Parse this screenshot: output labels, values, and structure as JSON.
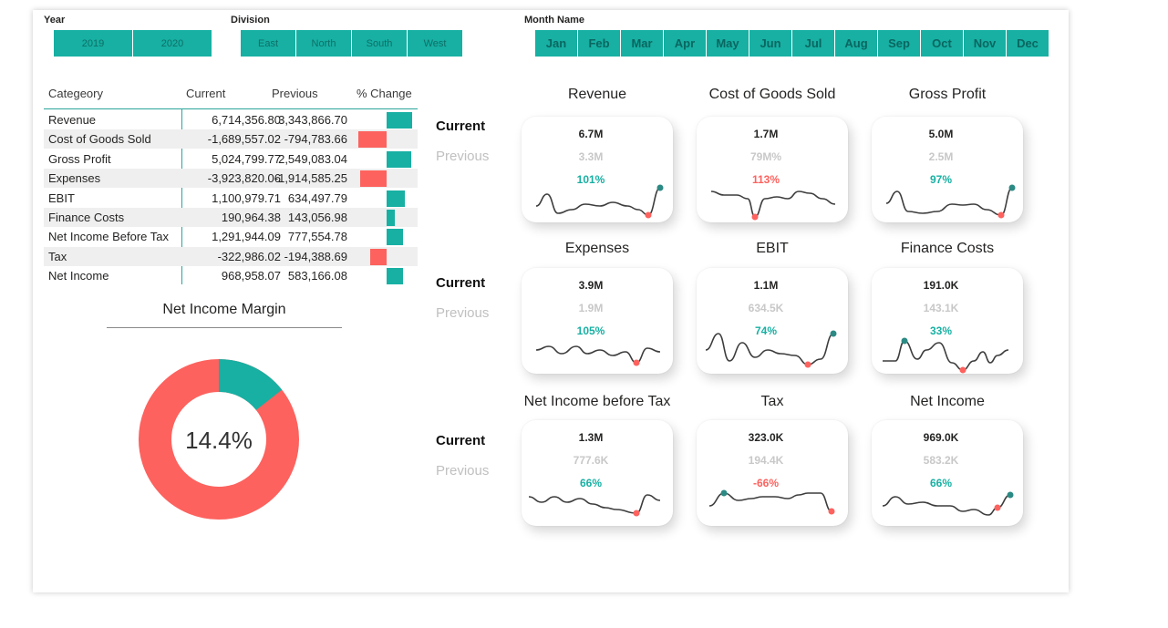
{
  "colors": {
    "teal": "#17b0a3",
    "red": "#fd625e",
    "dark_teal": "#2c8a84",
    "line": "#3d3d3d",
    "muted": "#c8c8c8"
  },
  "slicers": {
    "year": {
      "title": "Year",
      "items": [
        "2019",
        "2020"
      ]
    },
    "division": {
      "title": "Division",
      "items": [
        "East",
        "North",
        "South",
        "West"
      ]
    },
    "month": {
      "title": "Month Name",
      "items": [
        "Jan",
        "Feb",
        "Mar",
        "Apr",
        "May",
        "Jun",
        "Jul",
        "Aug",
        "Sep",
        "Oct",
        "Nov",
        "Dec"
      ]
    }
  },
  "table": {
    "headers": {
      "category": "Categeory",
      "current": "Current",
      "previous": "Previous",
      "change": "% Change"
    },
    "rows": [
      {
        "category": "Revenue",
        "current": "6,714,356.80",
        "previous": "3,343,866.70",
        "change_ratio": 1.01
      },
      {
        "category": "Cost of Goods Sold",
        "current": "-1,689,557.02",
        "previous": "-794,783.66",
        "change_ratio": -1.13
      },
      {
        "category": "Gross Profit",
        "current": "5,024,799.77",
        "previous": "2,549,083.04",
        "change_ratio": 0.97
      },
      {
        "category": "Expenses",
        "current": "-3,923,820.06",
        "previous": "-1,914,585.25",
        "change_ratio": -1.05
      },
      {
        "category": "EBIT",
        "current": "1,100,979.71",
        "previous": "634,497.79",
        "change_ratio": 0.74
      },
      {
        "category": "Finance Costs",
        "current": "190,964.38",
        "previous": "143,056.98",
        "change_ratio": 0.33
      },
      {
        "category": "Net Income Before Tax",
        "current": "1,291,944.09",
        "previous": "777,554.78",
        "change_ratio": 0.66
      },
      {
        "category": "Tax",
        "current": "-322,986.02",
        "previous": "-194,388.69",
        "change_ratio": -0.66
      },
      {
        "category": "Net Income",
        "current": "968,958.07",
        "previous": "583,166.08",
        "change_ratio": 0.66
      }
    ]
  },
  "donut": {
    "title": "Net Income Margin",
    "label": "14.4%",
    "value_pct": 14.4
  },
  "legend": {
    "current": "Current",
    "previous": "Previous"
  },
  "cards": [
    {
      "title": "Revenue",
      "current": "6.7M",
      "previous": "3.3M",
      "pct": "101%",
      "pct_color": "teal"
    },
    {
      "title": "Cost of Goods Sold",
      "current": "1.7M",
      "previous": "79M%",
      "pct": "113%",
      "pct_color": "red"
    },
    {
      "title": "Gross Profit",
      "current": "5.0M",
      "previous": "2.5M",
      "pct": "97%",
      "pct_color": "teal"
    },
    {
      "title": "Expenses",
      "current": "3.9M",
      "previous": "1.9M",
      "pct": "105%",
      "pct_color": "teal"
    },
    {
      "title": "EBIT",
      "current": "1.1M",
      "previous": "634.5K",
      "pct": "74%",
      "pct_color": "teal"
    },
    {
      "title": "Finance Costs",
      "current": "191.0K",
      "previous": "143.1K",
      "pct": "33%",
      "pct_color": "teal"
    },
    {
      "title": "Net Income before Tax",
      "current": "1.3M",
      "previous": "777.6K",
      "pct": "66%",
      "pct_color": "teal"
    },
    {
      "title": "Tax",
      "current": "323.0K",
      "previous": "194.4K",
      "pct": "-66%",
      "pct_color": "red"
    },
    {
      "title": "Net Income",
      "current": "969.0K",
      "previous": "583.2K",
      "pct": "66%",
      "pct_color": "teal"
    }
  ]
}
